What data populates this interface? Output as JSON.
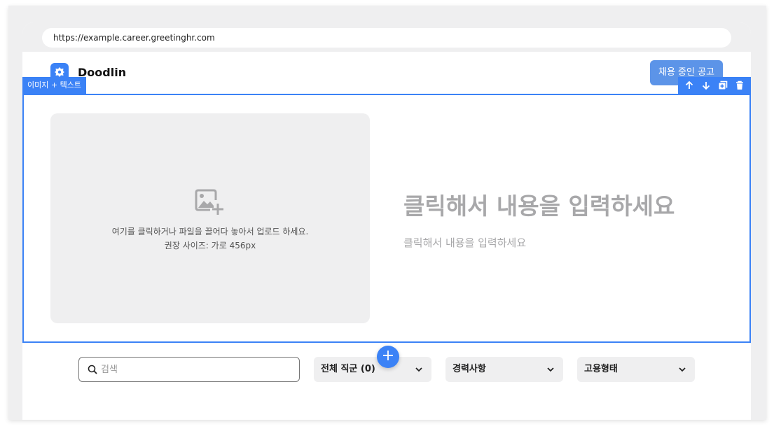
{
  "browser": {
    "url": "https://example.career.greetinghr.com"
  },
  "header": {
    "logo_text": "Doodlin",
    "recruit_button": "채용 중인 공고"
  },
  "editor_block": {
    "type_label": "이미지 + 텍스트",
    "tools": [
      "arrow-up-icon",
      "arrow-down-icon",
      "duplicate-icon",
      "trash-icon"
    ],
    "image_placeholder": {
      "hint": "여기를 클릭하거나 파일을 끌어다 놓아서 업로드 하세요.",
      "size_hint": "권장 사이즈: 가로 456px"
    },
    "title_placeholder": "클릭해서 내용을 입력하세요",
    "body_placeholder": "클릭해서 내용을 입력하세요",
    "add_block_label": "+"
  },
  "filters": {
    "search_placeholder": "검색",
    "dropdowns": [
      "전체 직군 (0)",
      "경력사항",
      "고용형태"
    ]
  },
  "colors": {
    "accent": "#3b82f6",
    "button": "#5c94e8",
    "placeholder": "#a8a8aa",
    "panel": "#efeff0"
  }
}
